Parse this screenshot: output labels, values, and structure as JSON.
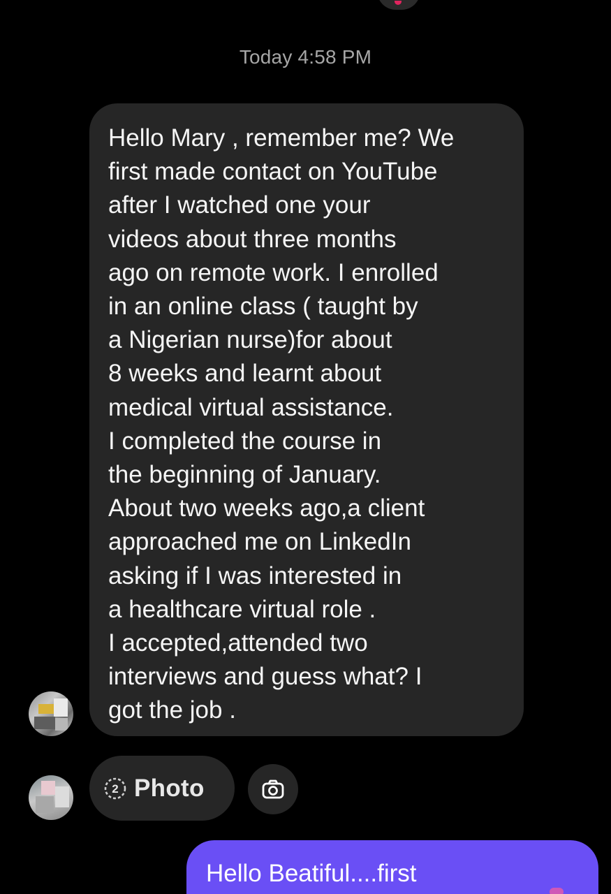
{
  "thread": {
    "timestamp": "Today 4:58 PM",
    "received_message": {
      "lines": [
        "Hello Mary , remember me? We",
        "first made contact on YouTube",
        "after I watched one your",
        "videos about three months",
        "ago on remote work. I enrolled",
        "in an online class ( taught by",
        "a Nigerian nurse)for about",
        "8 weeks and learnt about",
        "medical virtual assistance.",
        "I completed the course in",
        "the beginning of January.",
        "About two weeks ago,a client",
        "approached me on LinkedIn",
        "asking if I was interested in",
        "a healthcare virtual role .",
        "I accepted,attended two",
        "interviews and guess what? I",
        "got the job ."
      ]
    },
    "photo_attachment": {
      "count": "2",
      "label": "Photo"
    },
    "sent_message": {
      "text": "Hello Beatiful....first"
    }
  },
  "icons": {
    "photo_count": "photo-count-icon",
    "camera": "camera-icon"
  },
  "colors": {
    "background": "#000000",
    "received_bubble": "#262626",
    "sent_bubble": "#6a4ff5",
    "timestamp_text": "#a6a6a6"
  }
}
